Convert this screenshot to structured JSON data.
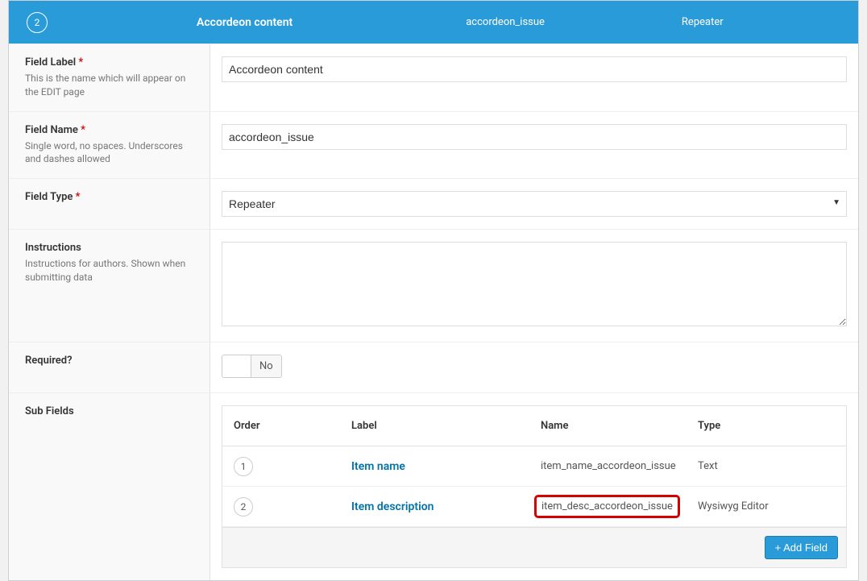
{
  "header": {
    "order": "2",
    "label": "Accordeon content",
    "name": "accordeon_issue",
    "type": "Repeater"
  },
  "fields": {
    "fieldLabel": {
      "label": "Field Label",
      "desc": "This is the name which will appear on the EDIT page",
      "value": "Accordeon content"
    },
    "fieldName": {
      "label": "Field Name",
      "desc": "Single word, no spaces. Underscores and dashes allowed",
      "value": "accordeon_issue"
    },
    "fieldType": {
      "label": "Field Type",
      "value": "Repeater"
    },
    "instructions": {
      "label": "Instructions",
      "desc": "Instructions for authors. Shown when submitting data",
      "value": ""
    },
    "required": {
      "label": "Required?",
      "value": "No"
    },
    "subFields": {
      "label": "Sub Fields",
      "columns": {
        "order": "Order",
        "label": "Label",
        "name": "Name",
        "type": "Type"
      },
      "rows": [
        {
          "order": "1",
          "label": "Item name",
          "name": "item_name_accordeon_issue",
          "type": "Text"
        },
        {
          "order": "2",
          "label": "Item description",
          "name": "item_desc_accordeon_issue",
          "type": "Wysiwyg Editor"
        }
      ],
      "addButton": "+ Add Field"
    }
  }
}
